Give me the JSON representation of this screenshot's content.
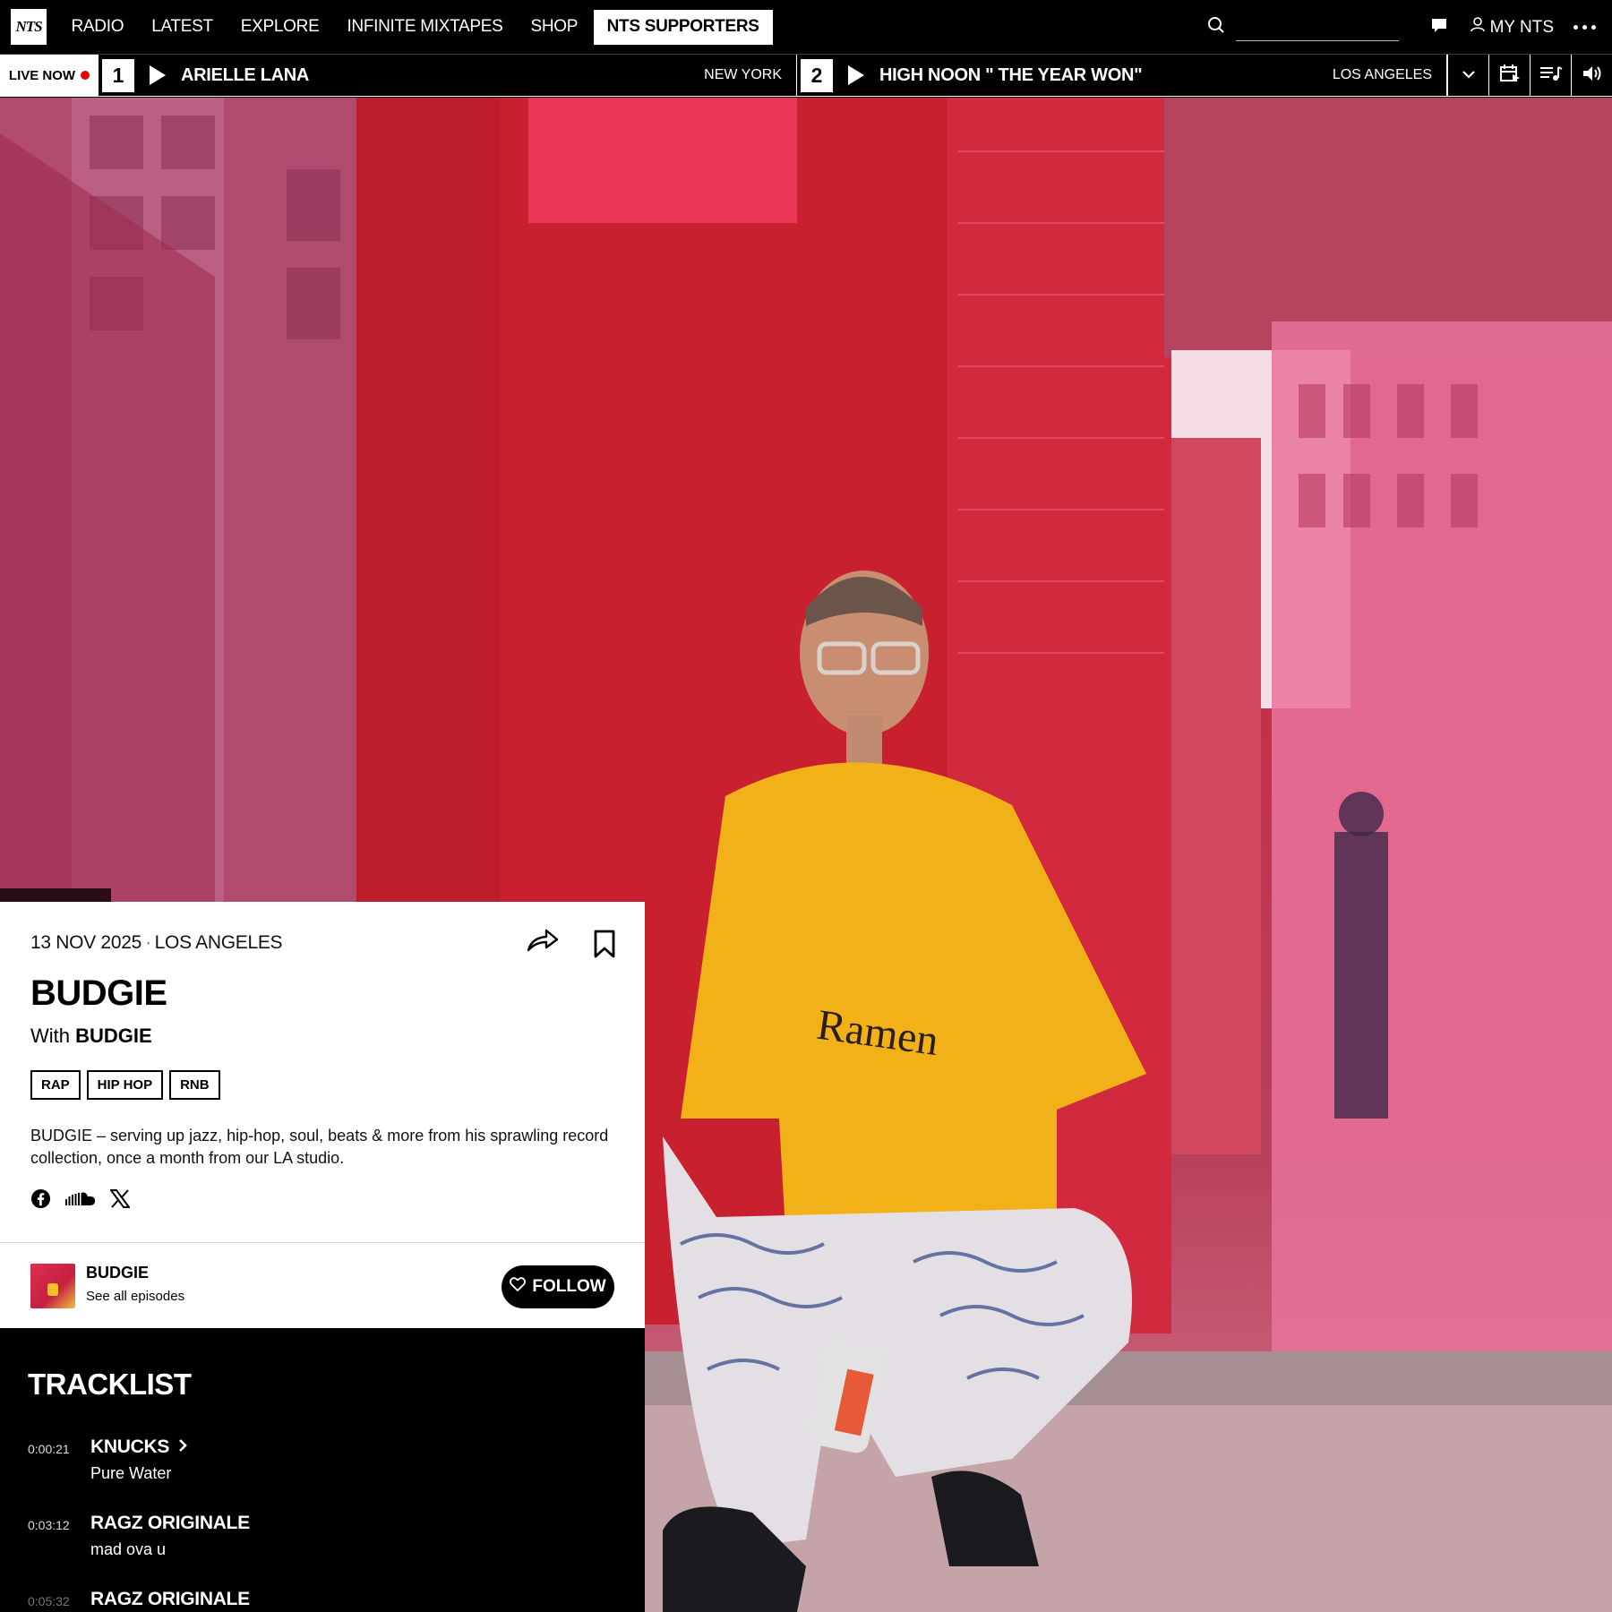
{
  "nav": {
    "logo": "NTS",
    "items": [
      "RADIO",
      "LATEST",
      "EXPLORE",
      "INFINITE MIXTAPES",
      "SHOP"
    ],
    "supporters_label": "NTS SUPPORTERS",
    "search_placeholder": "",
    "my_nts_label": "MY NTS"
  },
  "live": {
    "label": "LIVE NOW",
    "channels": [
      {
        "number": "1",
        "title": "ARIELLE LANA",
        "location": "NEW YORK"
      },
      {
        "number": "2",
        "title": "HIGH NOON \" THE YEAR WON\"",
        "location": "LOS ANGELES"
      }
    ],
    "tool_icons": [
      "chevron-down-icon",
      "schedule-icon",
      "playlist-icon",
      "volume-icon"
    ]
  },
  "episode": {
    "date": "13 NOV 2025",
    "location": "LOS ANGELES",
    "title": "BUDGIE",
    "with_prefix": "With",
    "with_name": "BUDGIE",
    "tags": [
      "RAP",
      "HIP HOP",
      "RNB"
    ],
    "description": "BUDGIE – serving up jazz, hip-hop, soul, beats & more from his sprawling record collection, once a month from our LA studio.",
    "socials": [
      "facebook-icon",
      "soundcloud-icon",
      "x-icon"
    ]
  },
  "host": {
    "name": "BUDGIE",
    "sub": "See all episodes",
    "follow_label": "FOLLOW"
  },
  "tracklist": {
    "heading": "TRACKLIST",
    "tracks": [
      {
        "time": "0:00:21",
        "artist": "KNUCKS",
        "song": "Pure Water"
      },
      {
        "time": "0:03:12",
        "artist": "RAGZ ORIGINALE",
        "song": "mad ova u"
      },
      {
        "time": "0:05:32",
        "artist": "RAGZ ORIGINALE",
        "song": ""
      }
    ]
  },
  "colors": {
    "live_dot": "#e10600",
    "background": "#000000",
    "card": "#ffffff"
  }
}
